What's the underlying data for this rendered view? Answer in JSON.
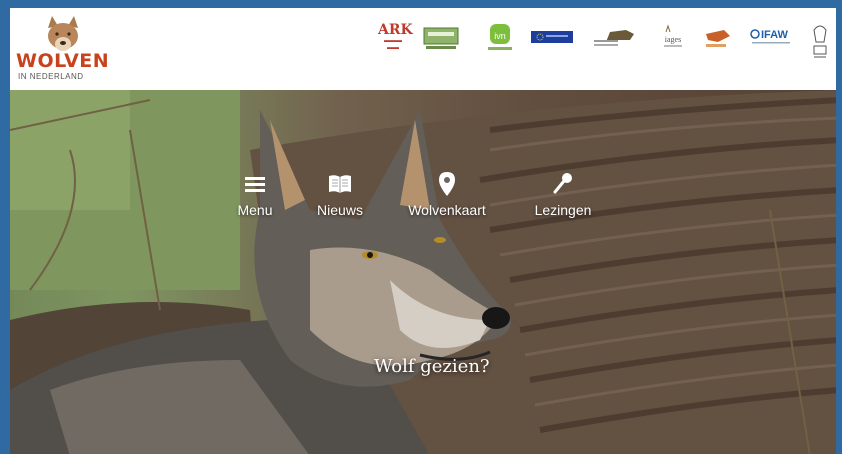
{
  "logo": {
    "word": "WOLVEN",
    "sub": "IN NEDERLAND"
  },
  "partners": [
    {
      "name": "ARK Natuurontwikkeling",
      "text": "ARK",
      "color": "#c0392b"
    },
    {
      "name": "Natuurmonumenten",
      "text": "",
      "color": "#5a8a3a"
    },
    {
      "name": "IVN",
      "text": "ivn",
      "color": "#6aaa2a"
    },
    {
      "name": "European Commission",
      "text": "",
      "color": "#1d3e9c"
    },
    {
      "name": "Wolf Fencing",
      "text": "",
      "color": "#7a6a4a"
    },
    {
      "name": "Dutch Wolf Society",
      "text": "",
      "color": "#555555"
    },
    {
      "name": "Wild animal fund",
      "text": "",
      "color": "#c0602a"
    },
    {
      "name": "IFAW",
      "text": "IFAW",
      "color": "#1d5fa8"
    },
    {
      "name": "FACE",
      "text": "",
      "color": "#777777"
    }
  ],
  "nav": [
    {
      "key": "menu",
      "label": "Menu",
      "icon": "menu-icon"
    },
    {
      "key": "nieuws",
      "label": "Nieuws",
      "icon": "newspaper-icon"
    },
    {
      "key": "wolvenkaart",
      "label": "Wolvenkaart",
      "icon": "map-pin-icon"
    },
    {
      "key": "lezingen",
      "label": "Lezingen",
      "icon": "microphone-icon"
    }
  ],
  "cta": {
    "label": "Wolf gezien?"
  },
  "colors": {
    "brand": "#c8431d",
    "frame": "#2f6aa3"
  }
}
